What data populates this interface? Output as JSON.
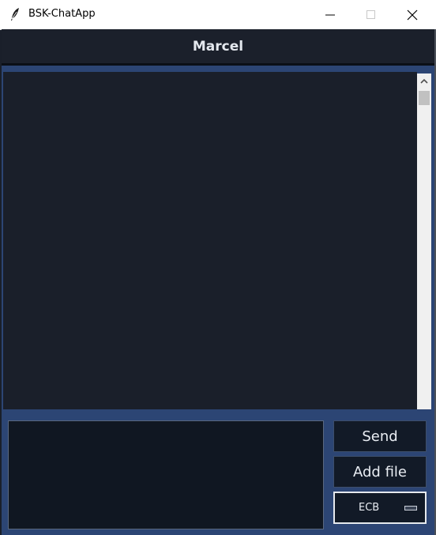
{
  "window": {
    "title": "BSK-ChatApp",
    "controls": {
      "minimize_icon": "minimize-icon",
      "maximize_icon": "maximize-icon",
      "close_icon": "close-icon"
    }
  },
  "header": {
    "title": "Marcel"
  },
  "chat": {
    "messages": []
  },
  "composer": {
    "message_value": "",
    "send_label": "Send",
    "add_file_label": "Add file",
    "mode": {
      "selected": "ECB"
    }
  },
  "colors": {
    "background": "#1a1f2a",
    "accent": "#2c4574",
    "text": "#e4e8ee"
  }
}
